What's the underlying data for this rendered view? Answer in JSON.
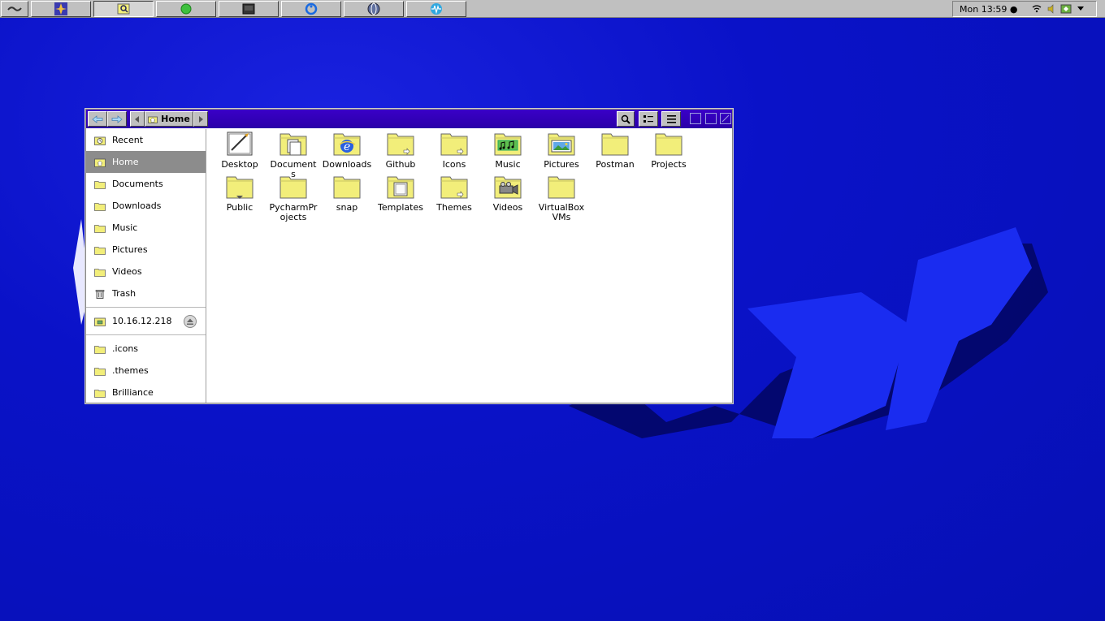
{
  "panel": {
    "tasks": [
      {
        "name": "menu",
        "icon": "menu-wave-icon"
      },
      {
        "name": "app-1",
        "icon": "star-compass-icon"
      },
      {
        "name": "app-2",
        "icon": "magnifier-icon",
        "pressed": true
      },
      {
        "name": "app-3",
        "icon": "green-orb-icon"
      },
      {
        "name": "app-4",
        "icon": "terminal-icon"
      },
      {
        "name": "app-5",
        "icon": "blue-ring-icon"
      },
      {
        "name": "app-6",
        "icon": "globe-icon"
      },
      {
        "name": "app-7",
        "icon": "waveform-icon"
      }
    ],
    "clock": "Mon 13:59 ●"
  },
  "window": {
    "breadcrumb": {
      "current": "Home"
    },
    "sidebar": {
      "places": [
        {
          "label": "Recent",
          "icon": "recent-icon"
        },
        {
          "label": "Home",
          "icon": "home-folder-icon",
          "active": true
        },
        {
          "label": "Documents",
          "icon": "folder-icon"
        },
        {
          "label": "Downloads",
          "icon": "folder-icon"
        },
        {
          "label": "Music",
          "icon": "folder-icon"
        },
        {
          "label": "Pictures",
          "icon": "folder-icon"
        },
        {
          "label": "Videos",
          "icon": "folder-icon"
        },
        {
          "label": "Trash",
          "icon": "trash-icon"
        }
      ],
      "network": [
        {
          "label": "10.16.12.218",
          "icon": "network-drive-icon"
        }
      ],
      "bookmarks": [
        {
          "label": ".icons",
          "icon": "folder-icon"
        },
        {
          "label": ".themes",
          "icon": "folder-icon"
        },
        {
          "label": "Brilliance",
          "icon": "folder-icon"
        }
      ]
    },
    "files": [
      {
        "label": "Desktop",
        "icon": "desktop-icon"
      },
      {
        "label": "Documents",
        "icon": "documents-folder-icon"
      },
      {
        "label": "Downloads",
        "icon": "downloads-folder-icon"
      },
      {
        "label": "Github",
        "icon": "folder-link-icon"
      },
      {
        "label": "Icons",
        "icon": "folder-link-icon"
      },
      {
        "label": "Music",
        "icon": "music-folder-icon"
      },
      {
        "label": "Pictures",
        "icon": "pictures-folder-icon"
      },
      {
        "label": "Postman",
        "icon": "folder-icon"
      },
      {
        "label": "Projects",
        "icon": "folder-icon"
      },
      {
        "label": "Public",
        "icon": "public-folder-icon"
      },
      {
        "label": "PycharmPr ojects",
        "icon": "folder-icon"
      },
      {
        "label": "snap",
        "icon": "folder-icon"
      },
      {
        "label": "Templates",
        "icon": "templates-folder-icon"
      },
      {
        "label": "Themes",
        "icon": "folder-link-icon"
      },
      {
        "label": "Videos",
        "icon": "videos-folder-icon"
      },
      {
        "label": "VirtualBox VMs",
        "icon": "folder-icon"
      }
    ]
  },
  "colors": {
    "desktop": "#0a12c8",
    "headerbar": "#3a00c8",
    "folder": "#f2ee7a",
    "selection": "#8c8c8c"
  }
}
